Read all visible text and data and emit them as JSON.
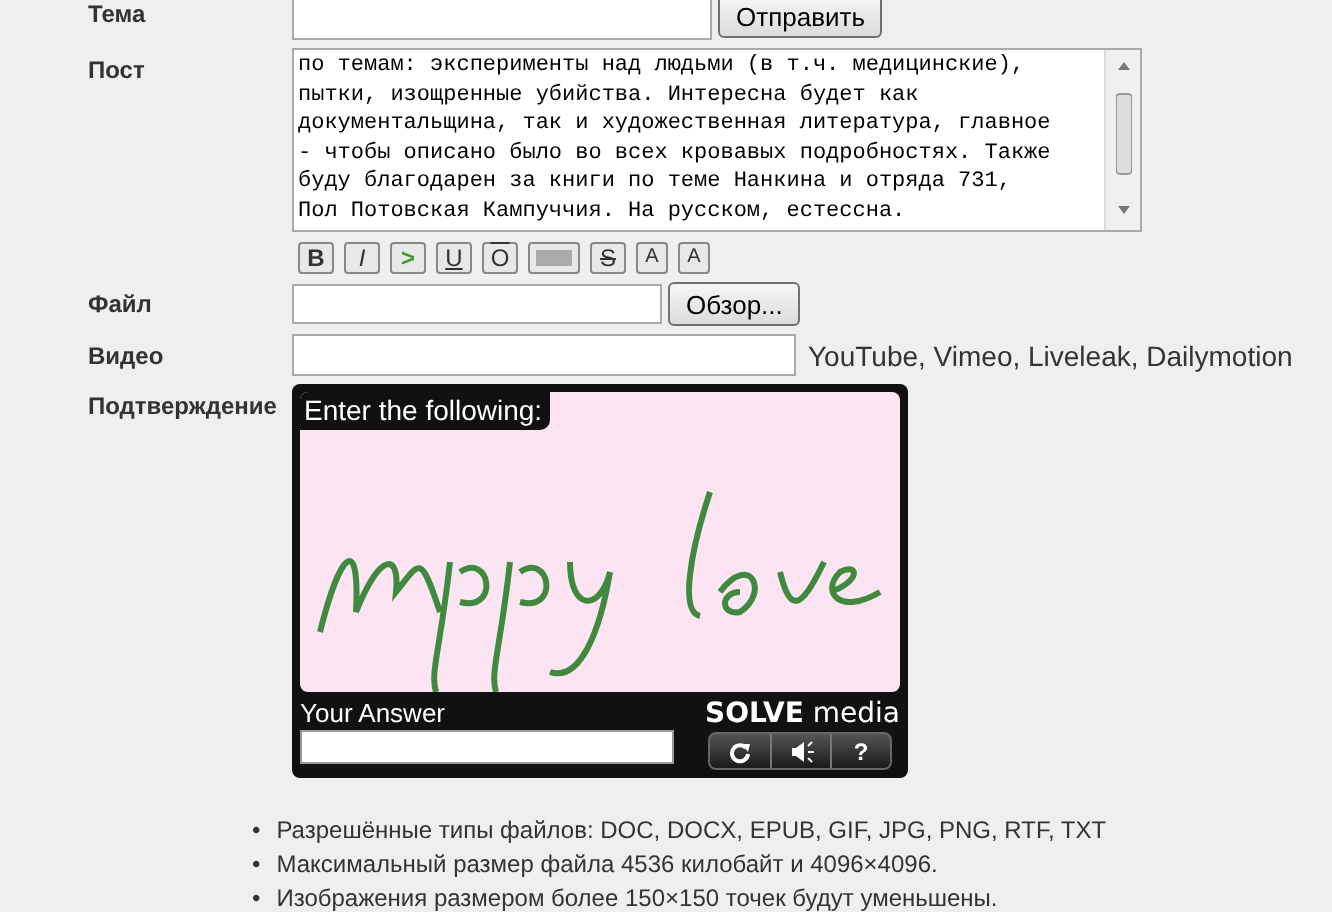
{
  "form": {
    "subject": {
      "label": "Тема",
      "submit": "Отправить"
    },
    "post": {
      "label": "Пост",
      "value": "по темам: эксперименты над людьми (в т.ч. медицинские),\nпытки, изощренные убийства. Интересна будет как\nдокументальщина, так и художественная литература, главное\n- чтобы описано было во всех кровавых подробностях. Также\nбуду благодарен за книги по теме Нанкина и отряда 731,\nПол Потовская Кампуччия. На русском, естессна."
    },
    "toolbar": [
      {
        "kind": "bold",
        "label": "B"
      },
      {
        "kind": "italic",
        "label": "I"
      },
      {
        "kind": "quote",
        "label": ">"
      },
      {
        "kind": "underline",
        "label": "U"
      },
      {
        "kind": "overline",
        "label": "O"
      },
      {
        "kind": "spoiler"
      },
      {
        "kind": "strike",
        "label": "S"
      },
      {
        "kind": "sub",
        "label": "A"
      },
      {
        "kind": "sup",
        "label": "A"
      }
    ],
    "file": {
      "label": "Файл",
      "browse": "Обзор..."
    },
    "video": {
      "label": "Видео",
      "hint": "YouTube, Vimeo, Liveleak, Dailymotion"
    },
    "captcha": {
      "label": "Подтверждение",
      "prompt": "Enter the following:",
      "answer_label": "Your Answer",
      "brand": "SOLVE",
      "brand_suffix": "media",
      "help": "?"
    }
  },
  "rules": [
    {
      "bullet": "•",
      "text": "Разрешённые типы файлов: DOC, DOCX, EPUB, GIF, JPG, PNG, RTF, TXT"
    },
    {
      "bullet": "•",
      "text": "Максимальный размер файла 4536 килобайт и 4096×4096."
    },
    {
      "bullet": "•",
      "text": "Изображения размером более 150×150 точек будут уменьшены."
    }
  ]
}
